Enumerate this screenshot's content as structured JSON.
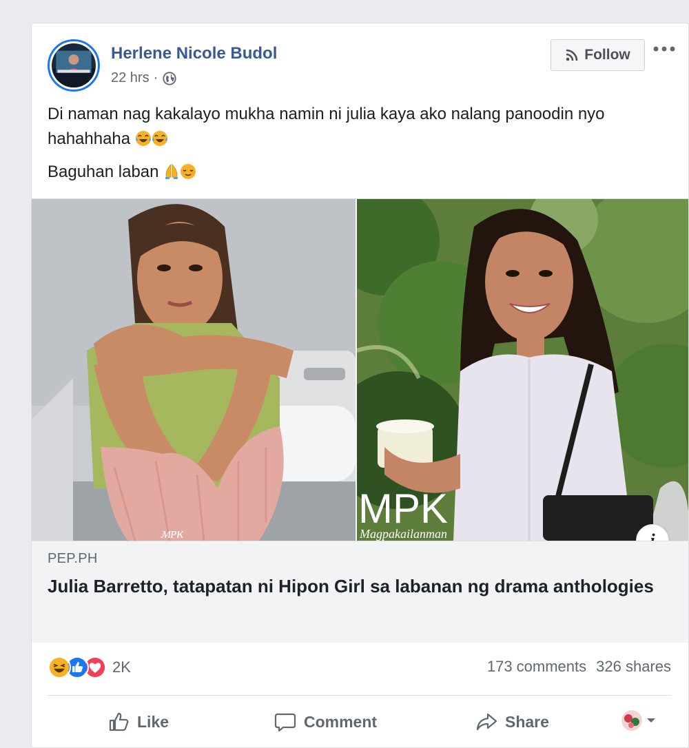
{
  "post": {
    "author": "Herlene Nicole Budol",
    "time": "22 hrs",
    "time_separator": "·",
    "follow_label": "Follow",
    "more_label": "•••",
    "text_line1": "Di naman nag kakalayo mukha namin ni julia kaya ako nalang panoodin nyo hahahhaha",
    "text_line2": "Baguhan laban"
  },
  "link": {
    "domain": "PEP.PH",
    "title": "Julia Barretto, tatapatan ni Hipon Girl sa labanan ng drama anthologies",
    "watermark": "MPK",
    "watermark_sub": "Magpakailanman",
    "info_label": "i"
  },
  "engagement": {
    "reaction_count": "2K",
    "comments": "173 comments",
    "shares": "326 shares",
    "reactions": [
      "haha-icon",
      "like-icon",
      "love-icon"
    ]
  },
  "actions": {
    "like": "Like",
    "comment": "Comment",
    "share": "Share"
  },
  "colors": {
    "link_blue": "#385898",
    "fb_blue": "#1877f2",
    "text_gray": "#606770",
    "love_red": "#f33e58",
    "haha_yellow": "#f7b125"
  }
}
